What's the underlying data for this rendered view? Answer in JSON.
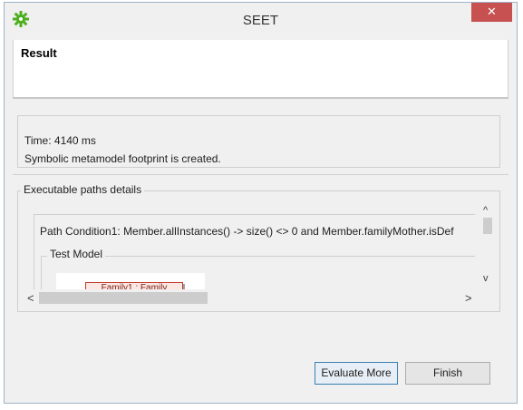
{
  "window": {
    "title": "SEET",
    "app_icon": "gear-icon",
    "close_symbol": "✕"
  },
  "header": {
    "title": "Result"
  },
  "info": {
    "time": "Time: 4140 ms",
    "message": "Symbolic metamodel footprint is created."
  },
  "paths": {
    "group_label": "Executable paths details",
    "path_condition": "Path Condition1: Member.allInstances() -> size() <> 0 and Member.familyMother.isDef",
    "test_model_label": "Test Model",
    "node_label": "Family1 : Family"
  },
  "scrollbars": {
    "up": "^",
    "down": "v",
    "left": "<",
    "right": ">"
  },
  "buttons": {
    "evaluate_more": "Evaluate More",
    "finish": "Finish"
  },
  "colors": {
    "icon_green": "#4caf1e",
    "close_red": "#c75050",
    "node_border": "#c0392b"
  }
}
